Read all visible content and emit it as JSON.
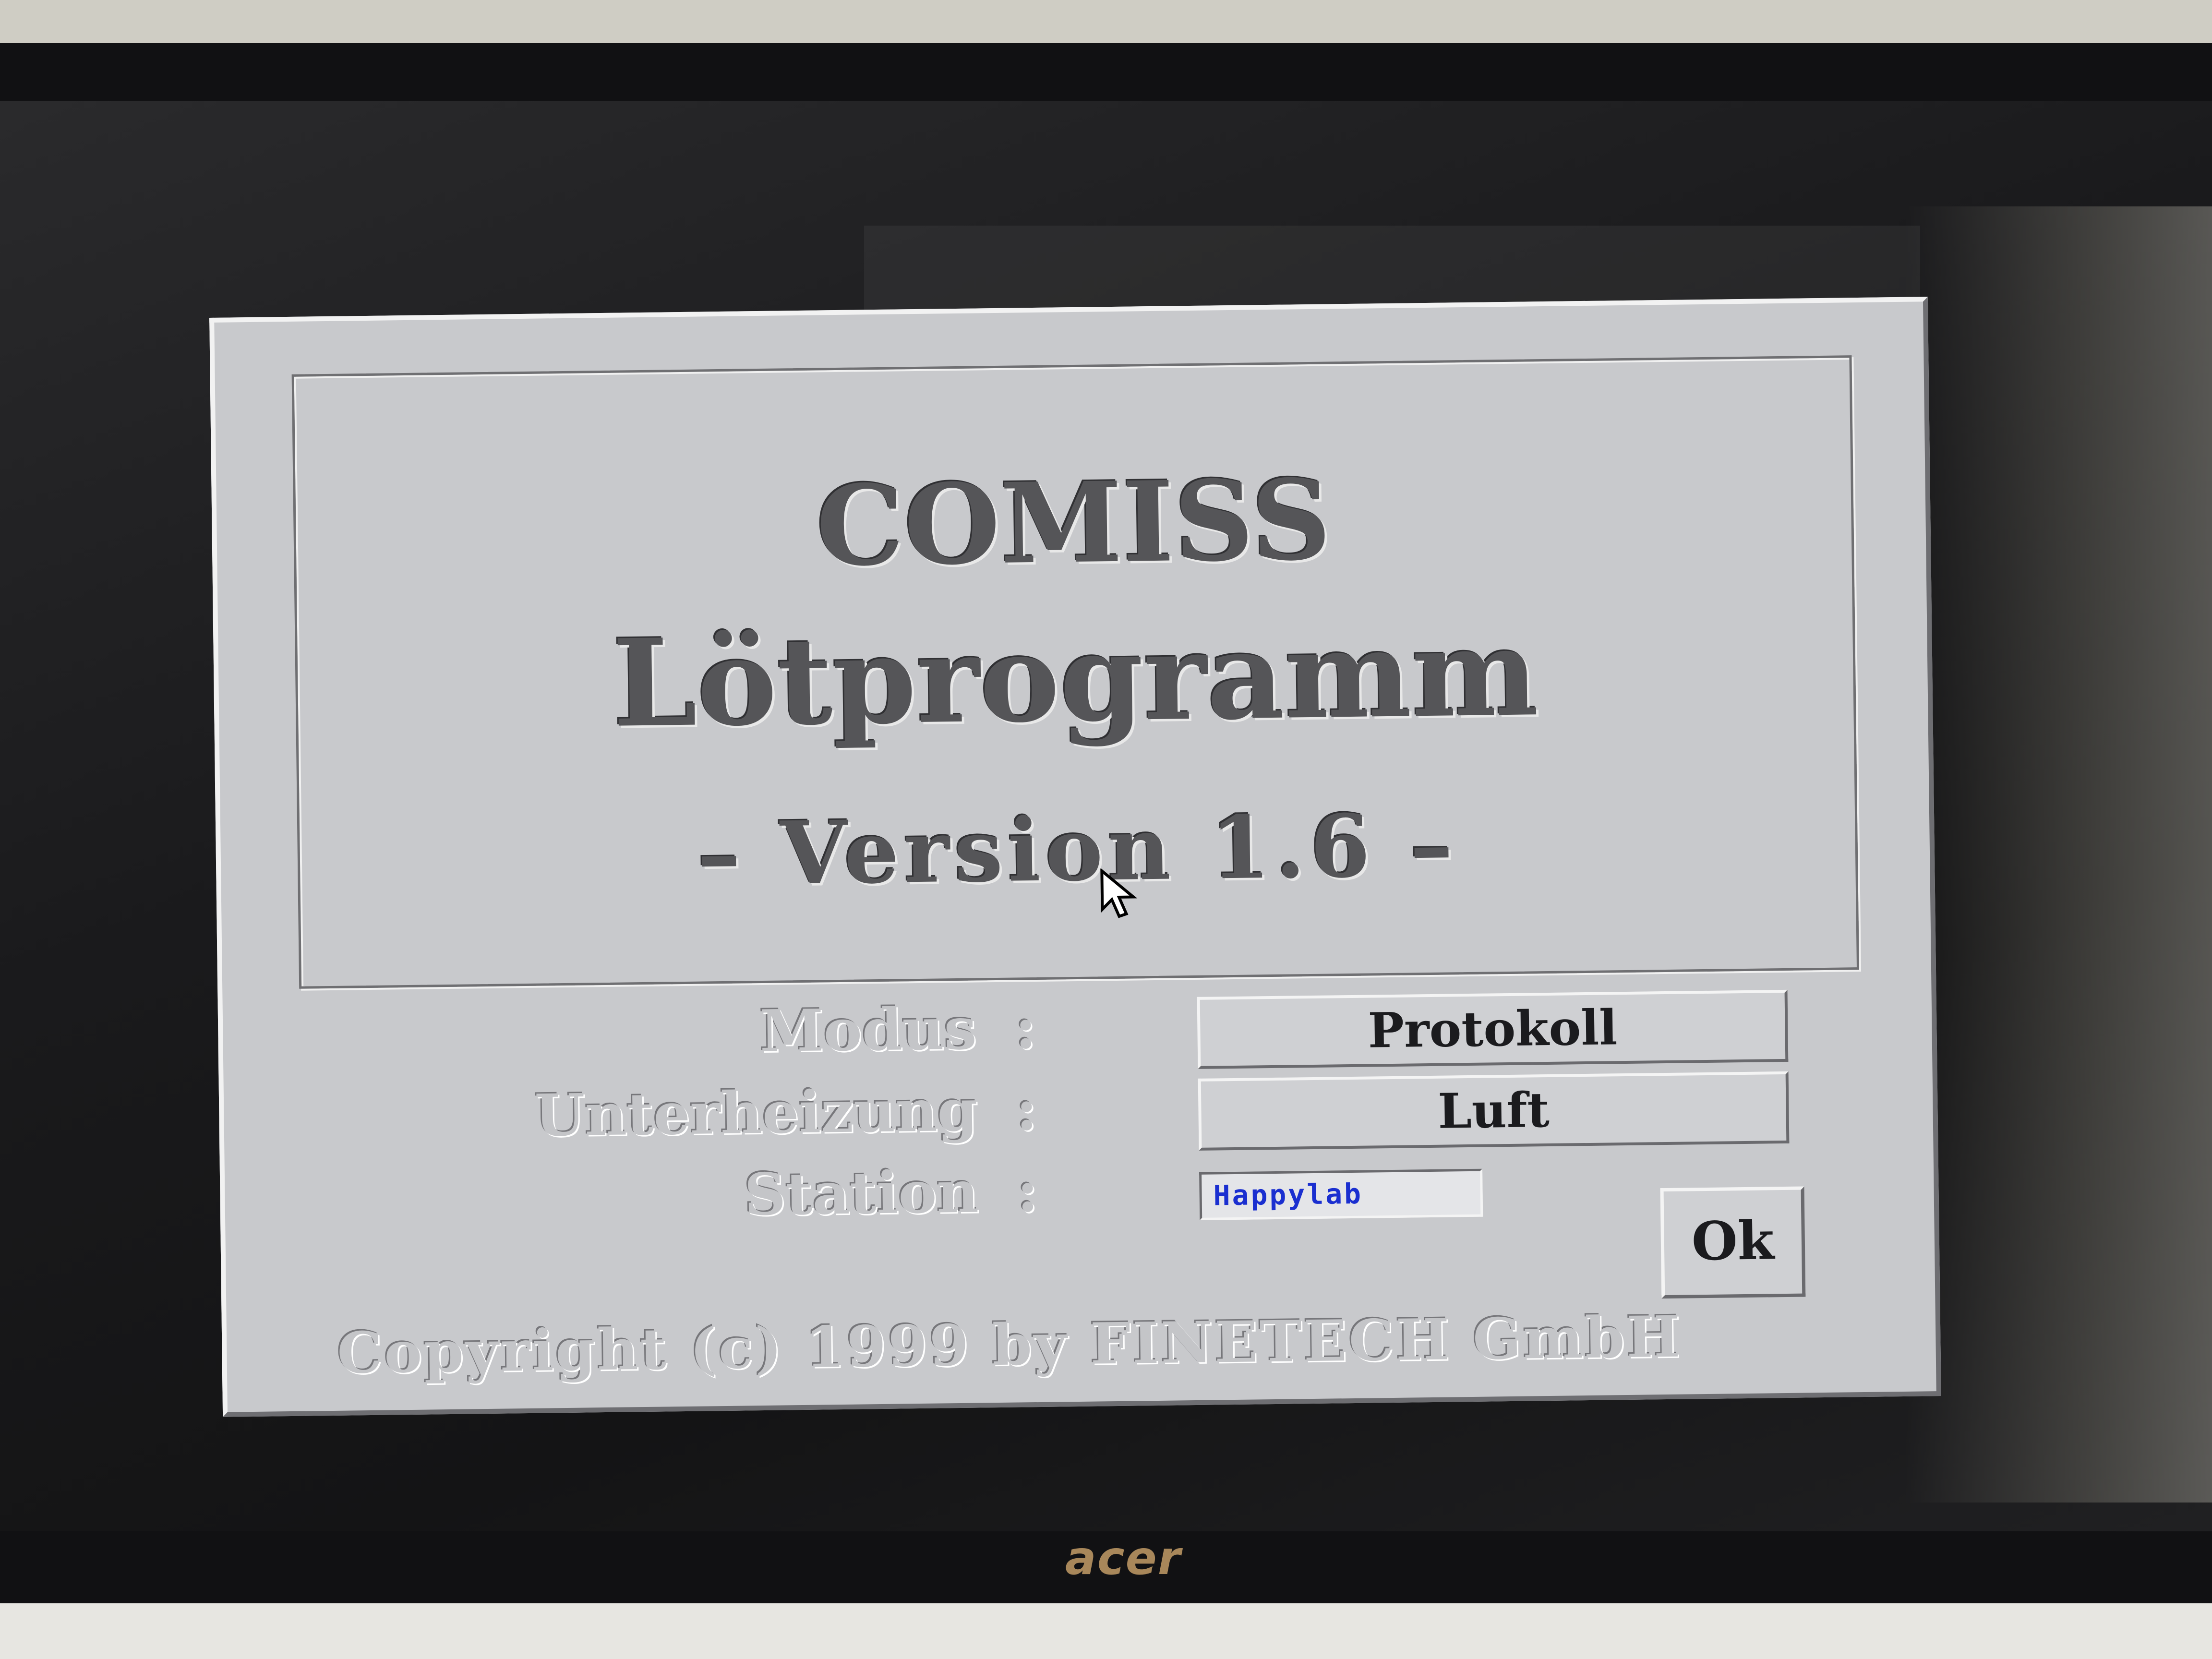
{
  "splash": {
    "app_name": "COMISS",
    "program_title": "Lötprogramm",
    "version_text": "– Version 1.6 –"
  },
  "form": {
    "mode": {
      "label": "Modus",
      "colon": ":",
      "value": "Protokoll"
    },
    "preheat": {
      "label": "Unterheizung",
      "colon": ":",
      "value": "Luft"
    },
    "station": {
      "label": "Station",
      "colon": ":",
      "value": "Happylab"
    }
  },
  "ok_button_label": "Ok",
  "copyright": "Copyright (c) 1999 by FINETECH GmbH",
  "monitor": {
    "brand": "acer"
  },
  "icons": {
    "cursor": "mouse-pointer-icon"
  },
  "colors": {
    "dialog_bg": "#c8c9cc",
    "station_text": "#1a2fd0"
  }
}
